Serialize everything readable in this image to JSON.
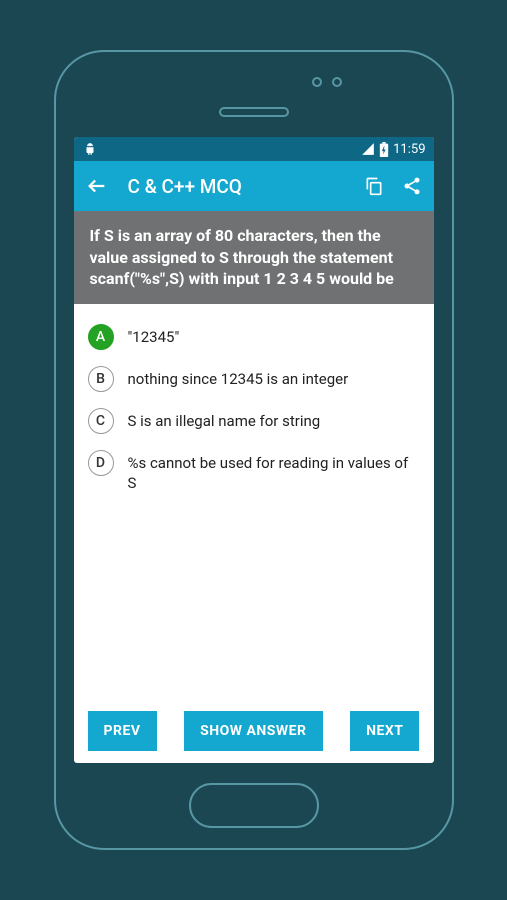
{
  "status": {
    "time": "11:59"
  },
  "appbar": {
    "title": "C & C++ MCQ"
  },
  "question": "If S is an array of 80 characters, then the value assigned to S through the statement scanf(\"%s\",S) with input 1 2 3 4 5 would be",
  "answers": [
    {
      "letter": "A",
      "text": "\"12345\"",
      "selected": true
    },
    {
      "letter": "B",
      "text": "nothing since 12345 is an integer",
      "selected": false
    },
    {
      "letter": "C",
      "text": "S is an illegal name for string",
      "selected": false
    },
    {
      "letter": "D",
      "text": "%s cannot be used for reading in values of S",
      "selected": false
    }
  ],
  "buttons": {
    "prev": "PREV",
    "show": "SHOW ANSWER",
    "next": "NEXT"
  }
}
